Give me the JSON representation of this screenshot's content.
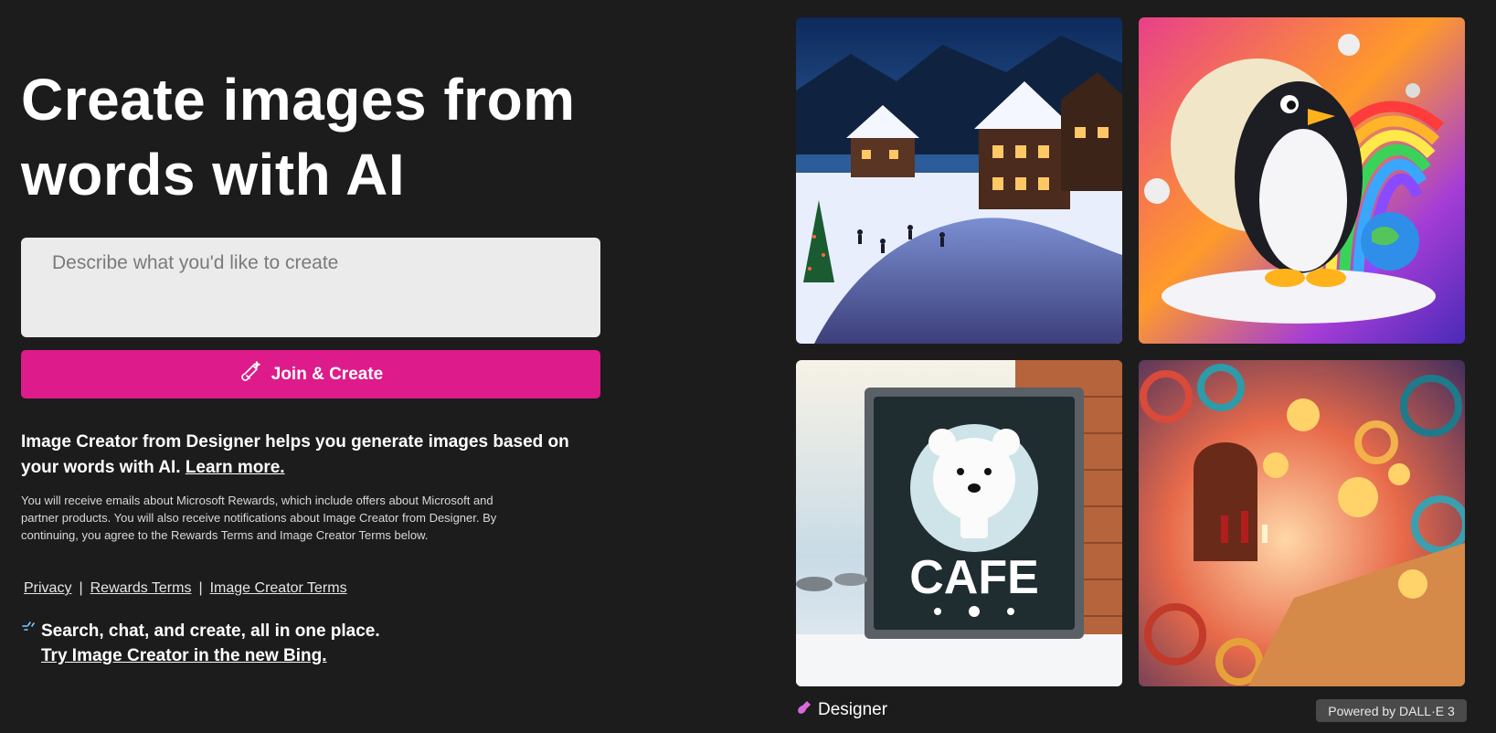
{
  "hero": {
    "title": "Create images from words with AI"
  },
  "prompt": {
    "placeholder": "Describe what you'd like to create",
    "value": ""
  },
  "create_button": {
    "label": "Join & Create",
    "icon": "magic-brush-icon"
  },
  "description": {
    "text": "Image Creator from Designer helps you generate images based on your words with AI.",
    "link": "Learn more."
  },
  "fine_print": "You will receive emails about Microsoft Rewards, which include offers about Microsoft and partner products. You will also receive notifications about Image Creator from Designer. By continuing, you agree to the Rewards Terms and Image Creator Terms below.",
  "footer_links": {
    "privacy": "Privacy",
    "separator": "|",
    "rewards_terms": "Rewards Terms",
    "image_creator_terms": "Image Creator Terms"
  },
  "promo": {
    "text": "Search, chat, and create, all in one place.",
    "link": "Try Image Creator in the new Bing.",
    "icon": "sparkle-icon"
  },
  "gallery": {
    "tiles": [
      {
        "name": "winter-village-image"
      },
      {
        "name": "penguin-rainbow-image"
      },
      {
        "name": "cafe-sign-image",
        "sign_text": "CAFE"
      },
      {
        "name": "paper-art-lanterns-image"
      }
    ]
  },
  "brand": {
    "name": "Designer",
    "icon": "designer-logo-icon"
  },
  "powered_by": "Powered by DALL·E 3",
  "colors": {
    "accent": "#de1b8a",
    "background": "#1c1c1c",
    "input": "#ebebeb"
  }
}
